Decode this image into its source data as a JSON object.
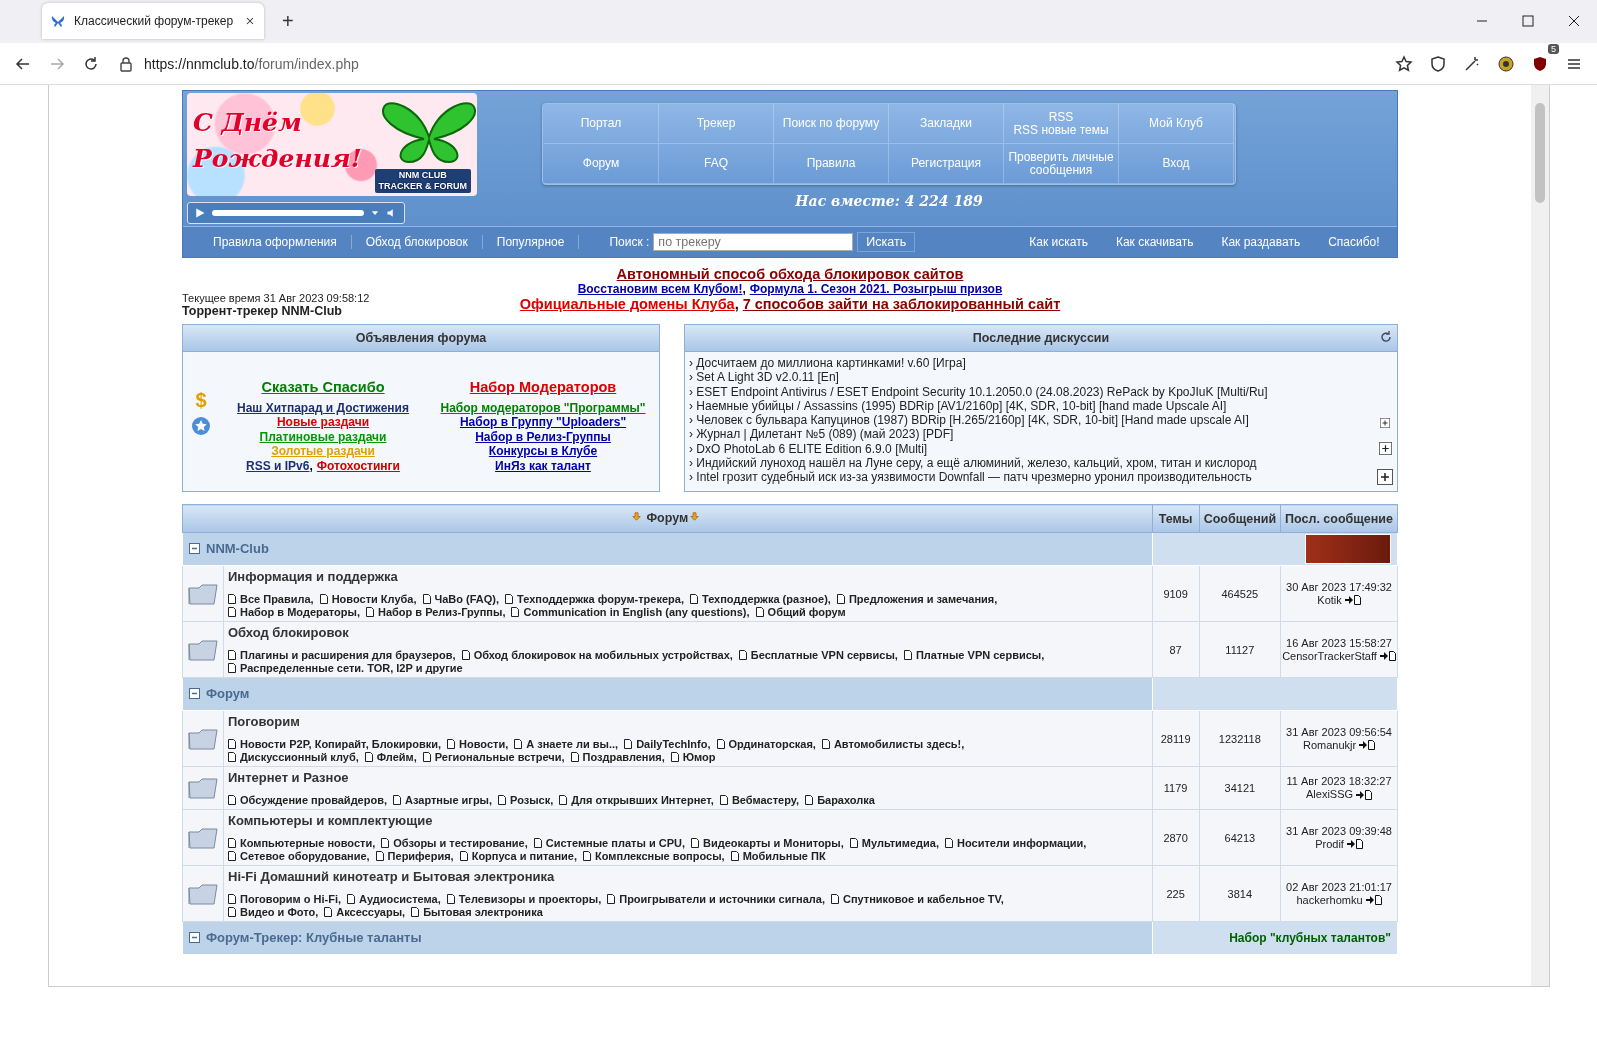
{
  "browser": {
    "tab_title": "Классический форум-трекер",
    "new_tab": "+",
    "url_host": "https://nnmclub.to",
    "url_path": "/forum/index.php",
    "extension_badge": "5"
  },
  "header": {
    "logo_title": "С Днём Рождения!",
    "logo_line1": "NNM CLUB",
    "logo_line2": "TRACKER & FORUM",
    "menu": [
      {
        "lines": [
          "Портал"
        ]
      },
      {
        "lines": [
          "Трекер"
        ]
      },
      {
        "lines": [
          "Поиск по форуму"
        ]
      },
      {
        "lines": [
          "Закладки"
        ]
      },
      {
        "lines": [
          "RSS",
          "RSS новые темы"
        ]
      },
      {
        "lines": [
          "Мой Клуб"
        ]
      },
      {
        "lines": [
          "Форум"
        ]
      },
      {
        "lines": [
          "FAQ"
        ]
      },
      {
        "lines": [
          "Правила"
        ]
      },
      {
        "lines": [
          "Регистрация"
        ]
      },
      {
        "lines": [
          "Проверить личные",
          "сообщения"
        ]
      },
      {
        "lines": [
          "Вход"
        ]
      }
    ],
    "members": "Нас вместе: 4 224 189"
  },
  "subnav": {
    "left_links": [
      "Правила оформления",
      "Обход блокировок",
      "Популярное"
    ],
    "search_label": "Поиск :",
    "search": {
      "placeholder": "по трекеру"
    },
    "search_button": "Искать",
    "right_links": [
      "Как искать",
      "Как скачивать",
      "Как раздавать",
      "Спасибо!"
    ]
  },
  "info": {
    "time": "Текущее время 31 Авг 2023 09:58:12",
    "site": "Торрент-трекер NNM-Club",
    "lines": [
      {
        "kind": "large",
        "items": [
          {
            "text": "Автономный способ обхода блокировок сайтов",
            "color": "#8b0000"
          }
        ]
      },
      {
        "kind": "small",
        "items": [
          {
            "text": "Восстановим всем Клубом!",
            "color": "#0000aa"
          },
          {
            "text": ","
          },
          {
            "text": "Формула 1. Сезон 2021. Розыгрыш призов",
            "color": "#0000aa"
          }
        ]
      },
      {
        "kind": "large",
        "items": [
          {
            "text": "Официальные домены Клуба",
            "color": "#dd0000"
          },
          {
            "text": ","
          },
          {
            "text": "7 способов зайти на заблокированный сайт",
            "color": "#8b0000"
          }
        ]
      }
    ]
  },
  "announcements": {
    "title": "Объявления форума",
    "icon_glyph": "$",
    "left": [
      {
        "kind": "large",
        "items": [
          {
            "text": "Сказать Спасибо",
            "color": "#008000"
          }
        ]
      },
      {
        "kind": "normal",
        "items": [
          {
            "text": "Наш Хитпарад и Достижения",
            "color": "#1f2f6f"
          }
        ]
      },
      {
        "kind": "normal",
        "items": [
          {
            "text": "Новые раздачи",
            "color": "#dd0000"
          }
        ]
      },
      {
        "kind": "normal",
        "items": [
          {
            "text": "Платиновые раздачи",
            "color": "#009900"
          }
        ]
      },
      {
        "kind": "normal",
        "items": [
          {
            "text": "Золотые раздачи",
            "color": "#e0a000"
          }
        ]
      },
      {
        "kind": "normal",
        "items": [
          {
            "text": "RSS и IPv6",
            "color": "#1f2f6f"
          },
          {
            "text": ","
          },
          {
            "text": "Фотохостинги",
            "color": "#cc0000"
          }
        ]
      }
    ],
    "right": [
      {
        "kind": "large",
        "items": [
          {
            "text": "Набор Модераторов",
            "color": "#dd0000"
          }
        ]
      },
      {
        "kind": "normal",
        "items": [
          {
            "text": "Набор модераторов \"Программы\"",
            "color": "#008000"
          }
        ]
      },
      {
        "kind": "normal",
        "items": [
          {
            "text": "Набор в Группу \"Uploaders\"",
            "color": "#0000aa"
          }
        ]
      },
      {
        "kind": "normal",
        "items": [
          {
            "text": "Набор в Релиз-Группы",
            "color": "#0000aa"
          }
        ]
      },
      {
        "kind": "normal",
        "items": [
          {
            "text": "Конкурсы в Клубе",
            "color": "#0000aa"
          }
        ]
      },
      {
        "kind": "normal",
        "items": [
          {
            "text": "ИнЯз как талант",
            "color": "#0000aa"
          }
        ]
      }
    ]
  },
  "discussions": {
    "title": "Последние дискуссии",
    "bullet": "›",
    "items": [
      "Досчитаем до миллиона картинками! v.60 [Игра]",
      "Set A Light 3D v2.0.11 [En]",
      "ESET Endpoint Antivirus / ESET Endpoint Security 10.1.2050.0 (24.08.2023) RePack by KpoJIuK [Multi/Ru]",
      "Наемные убийцы / Assassins (1995) BDRip [AV1/2160p] [4K, SDR, 10-bit] [hand made Upscale AI]",
      "Человек с бульвара Капуцинов (1987) BDRip [H.265/2160p] [4K, SDR, 10-bit] [Hand made upscale AI]",
      "Журнал | Дилетант №5 (089) (май 2023) [PDF]",
      "DxO PhotoLab 6 ELITE Edition 6.9.0 [Multi]",
      "Индийский луноход нашёл на Луне серу, а ещё алюминий, железо, кальций, хром, титан и кислород",
      "Intel грозит судебный иск из-за уязвимости Downfall — патч чрезмерно уронил производительность"
    ]
  },
  "forum_table": {
    "columns": [
      "Форум",
      "Темы",
      "Сообщений",
      "Посл. сообщение"
    ],
    "categories": [
      {
        "name": "NNM-Club",
        "expanded": true,
        "banner": true,
        "forums": [
          {
            "name": "Информация и поддержка",
            "subforums": [
              "Все Правила,",
              "Новости Клуба,",
              "ЧаВо (FAQ),",
              "Техподдержка форум-трекера,",
              "Техподдержка (разное),",
              "Предложения и замечания,",
              "Набор в Модераторы,",
              "Набор в Релиз-Группы,",
              "Communication in English (any questions),",
              "Общий форум"
            ],
            "topics": "9109",
            "posts": "464525",
            "last_date": "30 Авг 2023 17:49:32",
            "last_user": "Kotik"
          },
          {
            "name": "Обход блокировок",
            "subforums": [
              "Плагины и расширения для браузеров,",
              "Обход блокировок на мобильных устройствах,",
              "Бесплатные VPN сервисы,",
              "Платные VPN сервисы,",
              "Распределенные сети. TOR, I2P и другие"
            ],
            "topics": "87",
            "posts": "11127",
            "last_date": "16 Авг 2023 15:58:27",
            "last_user": "CensorTrackerStaff"
          }
        ]
      },
      {
        "name": "Форум",
        "expanded": true,
        "banner": false,
        "forums": [
          {
            "name": "Поговорим",
            "subforums": [
              "Новости P2P, Копирайт, Блокировки,",
              "Новости,",
              "А знаете ли вы..,",
              "DailyTechInfo,",
              "Ординаторская,",
              "Автомобилисты здесь!,",
              "Дискуссионный клуб,",
              "Флейм,",
              "Региональные встречи,",
              "Поздравления,",
              "Юмор"
            ],
            "topics": "28119",
            "posts": "1232118",
            "last_date": "31 Авг 2023 09:56:54",
            "last_user": "Romanukjr"
          },
          {
            "name": "Интернет и Разное",
            "subforums": [
              "Обсуждение провайдеров,",
              "Азартные игры,",
              "Розыск,",
              "Для открывших Интернет,",
              "Вебмастеру,",
              "Барахолка"
            ],
            "topics": "1179",
            "posts": "34121",
            "last_date": "11 Авг 2023 18:32:27",
            "last_user": "AlexiSSG"
          },
          {
            "name": "Компьютеры и комплектующие",
            "subforums": [
              "Компьютерные новости,",
              "Обзоры и тестирование,",
              "Системные платы и CPU,",
              "Видеокарты и Мониторы,",
              "Мультимедиа,",
              "Носители информации,",
              "Сетевое оборудование,",
              "Периферия,",
              "Корпуса и питание,",
              "Комплексные вопросы,",
              "Мобильные ПК"
            ],
            "topics": "2870",
            "posts": "64213",
            "last_date": "31 Авг 2023 09:39:48",
            "last_user": "Prodif"
          },
          {
            "name": "Hi-Fi Домашний кинотеатр и Бытовая электроника",
            "subforums": [
              "Поговорим о Hi-Fi,",
              "Аудиосистема,",
              "Телевизоры и проекторы,",
              "Проигрыватели и источники сигнала,",
              "Спутниковое и кабельное TV,",
              "Видео и Фото,",
              "Аксессуары,",
              "Бытовая электроника"
            ],
            "topics": "225",
            "posts": "3814",
            "last_date": "02 Авг 2023 21:01:17",
            "last_user": "hackerhomku"
          }
        ]
      },
      {
        "name": "Форум-Трекер: Клубные таланты",
        "expanded": true,
        "banner": false,
        "side_link": "Набор \"клубных талантов\""
      }
    ]
  }
}
